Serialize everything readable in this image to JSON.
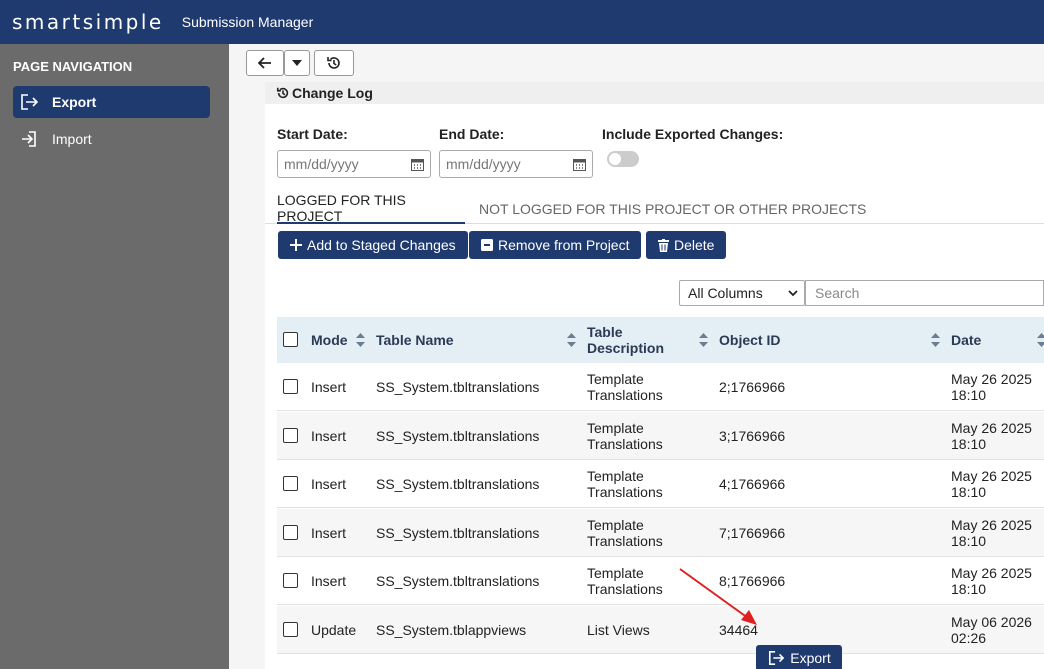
{
  "header": {
    "logo": "smartsimple",
    "app_name": "Submission Manager"
  },
  "sidebar": {
    "title": "PAGE NAVIGATION",
    "items": [
      {
        "label": "Export",
        "icon": "export-icon",
        "active": true
      },
      {
        "label": "Import",
        "icon": "import-icon",
        "active": false
      }
    ]
  },
  "toolbar": {
    "back_icon": "arrow-left-icon",
    "dropdown_icon": "caret-down-icon",
    "history_icon": "history-icon"
  },
  "panel": {
    "title": "Change Log",
    "start_date_label": "Start Date:",
    "end_date_label": "End Date:",
    "include_label": "Include Exported Changes:",
    "date_placeholder": "mm/dd/yyyy",
    "include_exported": false
  },
  "tabs": [
    {
      "label": "LOGGED FOR THIS PROJECT",
      "active": true
    },
    {
      "label": "NOT LOGGED FOR THIS PROJECT OR OTHER PROJECTS",
      "active": false
    }
  ],
  "actions": {
    "add": "Add to Staged Changes",
    "remove": "Remove from Project",
    "delete": "Delete"
  },
  "filter": {
    "selected": "All Columns",
    "search_placeholder": "Search"
  },
  "table": {
    "columns": [
      "Mode",
      "Table Name",
      "Table Description",
      "Object ID",
      "Date"
    ],
    "rows": [
      {
        "mode": "Insert",
        "table_name": "SS_System.tbltranslations",
        "desc": "Template Translations",
        "object_id": "2;1766966",
        "date": "May 26 2025 18:10"
      },
      {
        "mode": "Insert",
        "table_name": "SS_System.tbltranslations",
        "desc": "Template Translations",
        "object_id": "3;1766966",
        "date": "May 26 2025 18:10"
      },
      {
        "mode": "Insert",
        "table_name": "SS_System.tbltranslations",
        "desc": "Template Translations",
        "object_id": "4;1766966",
        "date": "May 26 2025 18:10"
      },
      {
        "mode": "Insert",
        "table_name": "SS_System.tbltranslations",
        "desc": "Template Translations",
        "object_id": "7;1766966",
        "date": "May 26 2025 18:10"
      },
      {
        "mode": "Insert",
        "table_name": "SS_System.tbltranslations",
        "desc": "Template Translations",
        "object_id": "8;1766966",
        "date": "May 26 2025 18:10"
      },
      {
        "mode": "Update",
        "table_name": "SS_System.tblappviews",
        "desc": "List Views",
        "object_id": "34464",
        "date": "May 06 2026 02:26"
      }
    ]
  },
  "footer": {
    "export_label": "Export"
  },
  "colors": {
    "brand": "#1f3a6e",
    "sidebar": "#6b6b6b",
    "annotation_arrow": "#e02020"
  }
}
